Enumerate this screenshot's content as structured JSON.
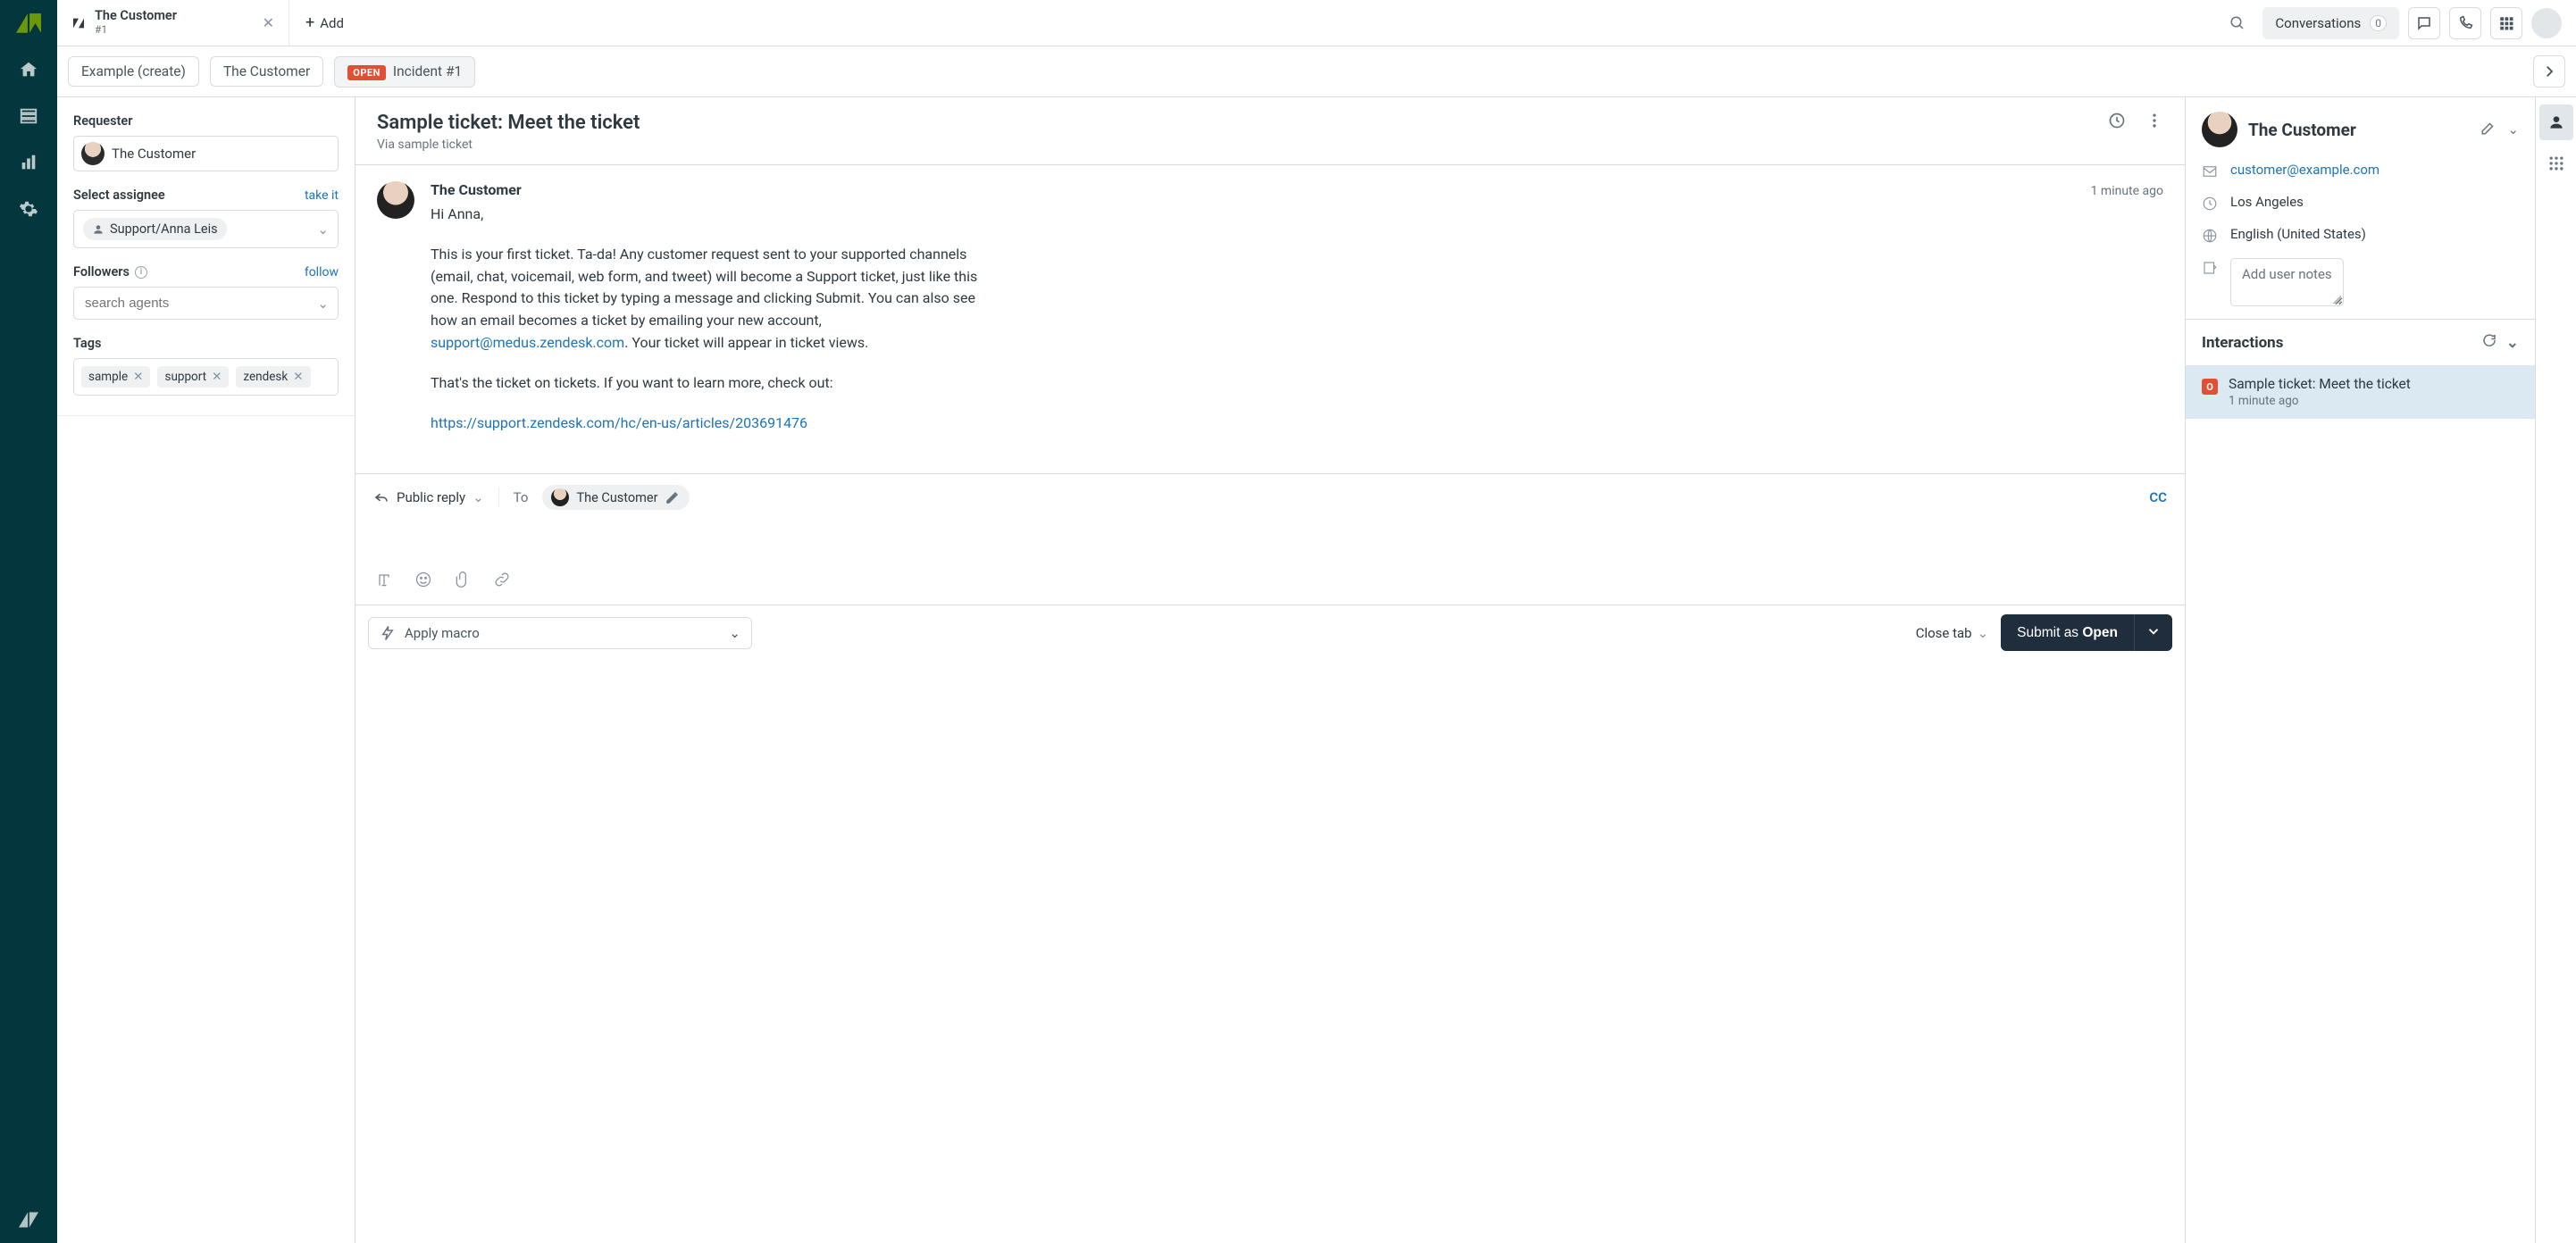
{
  "topbar": {
    "tab": {
      "title": "The Customer",
      "subtitle": "#1"
    },
    "add_label": "Add",
    "conversations": {
      "label": "Conversations",
      "count": "0"
    }
  },
  "breadcrumb": {
    "a": "Example (create)",
    "b": "The Customer",
    "status": "OPEN",
    "c": "Incident #1"
  },
  "left": {
    "requester_label": "Requester",
    "requester_name": "The Customer",
    "assignee_label": "Select assignee",
    "take_it": "take it",
    "assignee_value": "Support/Anna Leis",
    "followers_label": "Followers",
    "follow": "follow",
    "search_placeholder": "search agents",
    "tags_label": "Tags",
    "tags": [
      "sample",
      "support",
      "zendesk"
    ]
  },
  "ticket": {
    "title": "Sample ticket: Meet the ticket",
    "via": "Via sample ticket",
    "author": "The Customer",
    "time": "1 minute ago",
    "greeting": "Hi Anna,",
    "body_part1": "This is your first ticket. Ta-da! Any customer request sent to your supported channels (email, chat, voicemail, web form, and tweet) will become a Support ticket, just like this one. Respond to this ticket by typing a message and clicking Submit. You can also see how an email becomes a ticket by emailing your new account, ",
    "body_email": "support@medus.zendesk.com",
    "body_part2": ". Your ticket will appear in ticket views.",
    "body_part3": "That's the ticket on tickets. If you want to learn more, check out:",
    "body_link": "https://support.zendesk.com/hc/en-us/articles/203691476"
  },
  "reply": {
    "type_label": "Public reply",
    "to_label": "To",
    "to_name": "The Customer",
    "cc_label": "CC"
  },
  "footer": {
    "macro_label": "Apply macro",
    "close_tab": "Close tab",
    "submit_prefix": "Submit as ",
    "submit_status": "Open"
  },
  "customer": {
    "name": "The Customer",
    "email": "customer@example.com",
    "location": "Los Angeles",
    "language": "English (United States)",
    "notes_placeholder": "Add user notes",
    "interactions_label": "Interactions",
    "interaction_title": "Sample ticket: Meet the ticket",
    "interaction_time": "1 minute ago"
  }
}
